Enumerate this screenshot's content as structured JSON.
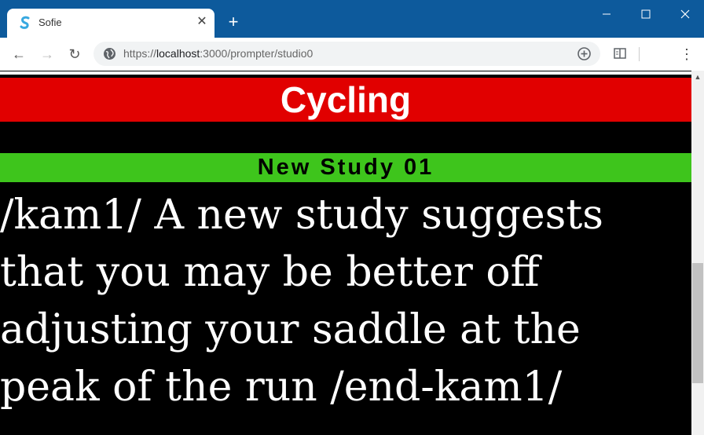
{
  "tab": {
    "title": "Sofie",
    "close_glyph": "✕",
    "new_tab_glyph": "+"
  },
  "window": {
    "minimize_glyph": "—",
    "close_glyph": "✕"
  },
  "toolbar": {
    "back_glyph": "←",
    "forward_glyph": "→",
    "reload_glyph": "↻",
    "menu_glyph": "⋮",
    "url_scheme": "https://",
    "url_host": "localhost",
    "url_rest": ":3000/prompter/studio0"
  },
  "prompter": {
    "segment_title": "Cycling",
    "part_title": "New Study 01",
    "script_text": "/kam1/ A new study suggests\nthat you may be better off\nadjusting your saddle at the\npeak of the run /end-kam1/",
    "colors": {
      "segment_bg": "#e10000",
      "part_bg": "#3ec51c"
    }
  },
  "icons": {
    "favicon": "sofie-logo-icon",
    "site_info": "globe-icon",
    "add": "plus-circle-icon",
    "reader": "reader-mode-icon"
  }
}
